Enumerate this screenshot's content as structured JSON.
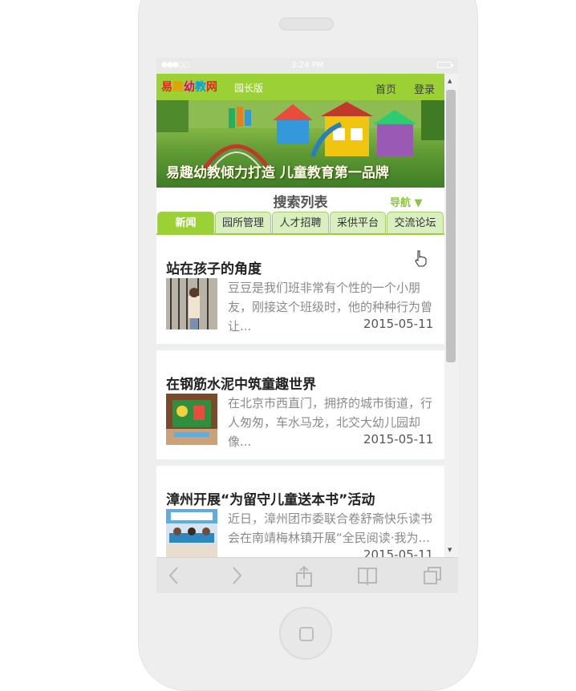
{
  "status_bar": {
    "signal": "●●●○○",
    "time": "3:24 PM"
  },
  "header": {
    "logo_chars": [
      "易",
      "趣",
      "幼",
      "教",
      "网"
    ],
    "logo_colors": [
      "#e8251f",
      "#f39800",
      "#e4007f",
      "#00a0e9",
      "#e8251f"
    ],
    "edition": "园长版",
    "nav_home": "首页",
    "nav_login": "登录"
  },
  "banner": {
    "caption": "易趣幼教倾力打造  儿童教育第一品牌"
  },
  "search": {
    "title": "搜索列表",
    "nav_toggle": "导航 ▼"
  },
  "tabs": [
    "新闻",
    "园所管理",
    "人才招聘",
    "采供平台",
    "交流论坛"
  ],
  "tab_more": "≡",
  "articles": [
    {
      "title": "站在孩子的角度",
      "summary": "豆豆是我们班非常有个性的一个小朋友，刚接这个班级时，他的种种行为曾让...",
      "date": "2015-05-11"
    },
    {
      "title": "在钢筋水泥中筑童趣世界",
      "summary": "在北京市西直门，拥挤的城市街道，行人匆匆，车水马龙，北交大幼儿园却像...",
      "date": "2015-05-11"
    },
    {
      "title": "漳州开展“为留守儿童送本书”活动",
      "summary": "近日，漳州团市委联合卷舒斋快乐读书会在南靖梅林镇开展“全民阅读·我为...",
      "date": "2015-05-11"
    }
  ],
  "colors": {
    "accent": "#9cd136",
    "tab_bg": "#d9efbf",
    "date": "#555555"
  },
  "toolbar_icons": [
    "back-icon",
    "forward-icon",
    "share-icon",
    "bookmarks-icon",
    "tabs-icon"
  ]
}
